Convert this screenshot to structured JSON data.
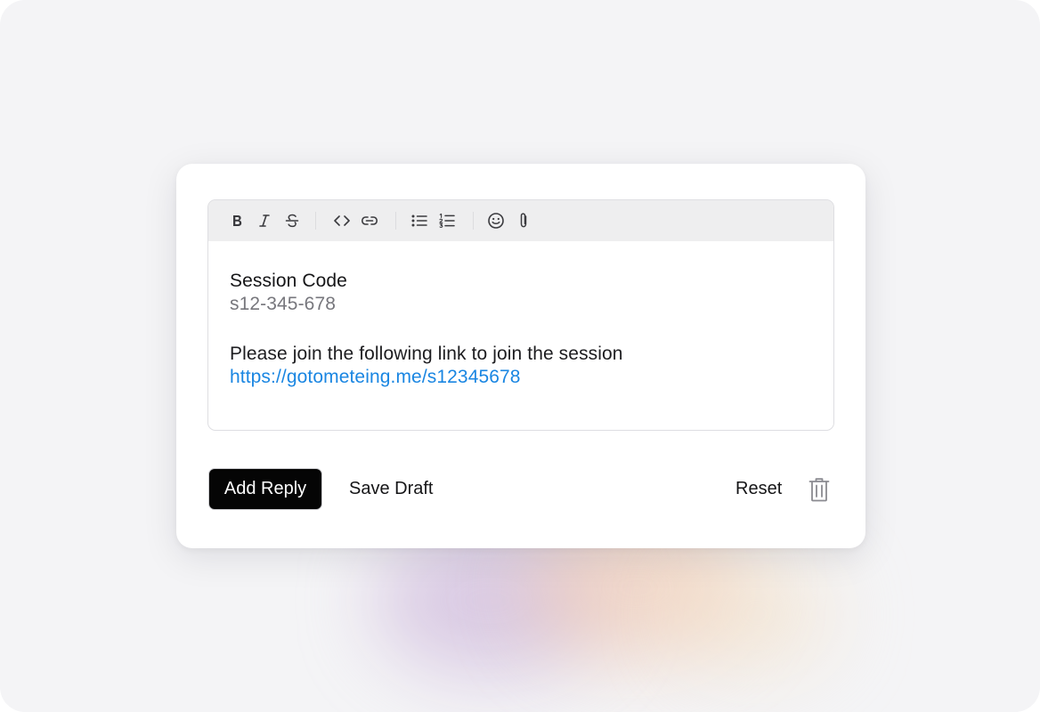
{
  "toolbar": {
    "buttons": [
      {
        "name": "bold",
        "icon": "bold-icon"
      },
      {
        "name": "italic",
        "icon": "italic-icon"
      },
      {
        "name": "strikethrough",
        "icon": "strikethrough-icon"
      },
      {
        "name": "code",
        "icon": "code-icon"
      },
      {
        "name": "link",
        "icon": "link-icon"
      },
      {
        "name": "bulleted-list",
        "icon": "bulleted-list-icon"
      },
      {
        "name": "numbered-list",
        "icon": "numbered-list-icon"
      },
      {
        "name": "emoji",
        "icon": "emoji-icon"
      },
      {
        "name": "attachment",
        "icon": "paperclip-icon"
      }
    ]
  },
  "editor": {
    "title": "Session Code",
    "code": "s12-345-678",
    "message": "Please join the following link to join the session",
    "link": "https://gotometeing.me/s12345678"
  },
  "actions": {
    "add_reply_label": "Add Reply",
    "save_draft_label": "Save Draft",
    "reset_label": "Reset",
    "delete_icon": "trash-icon"
  },
  "colors": {
    "link": "#1a86e2",
    "primary_button": "#050505",
    "toolbar_background": "#eeeeef",
    "page_background": "#f4f4f6"
  }
}
